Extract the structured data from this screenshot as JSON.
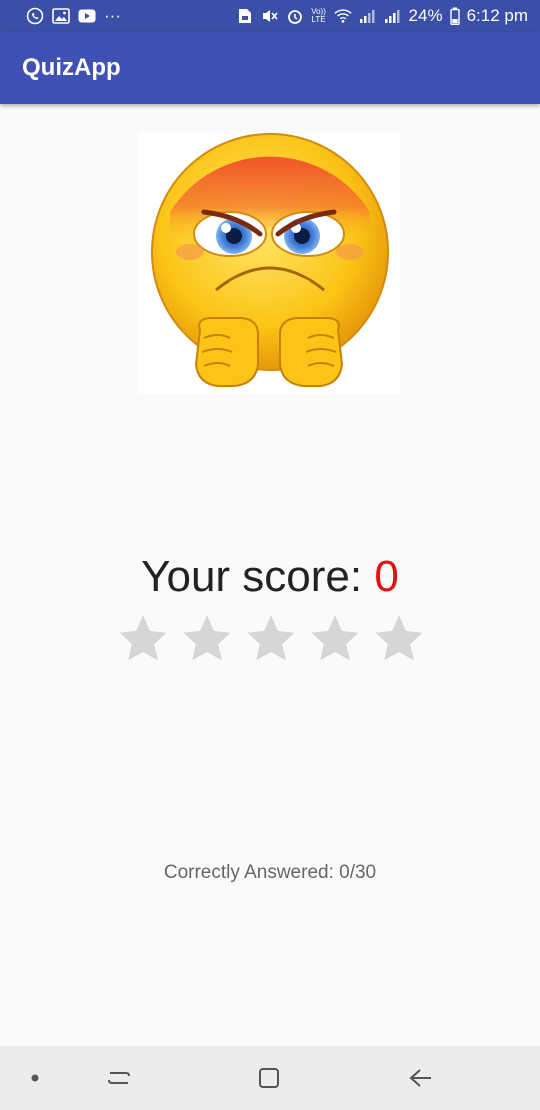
{
  "status_bar": {
    "battery_text": "24%",
    "time": "6:12 pm",
    "left_icons": [
      "whatsapp-icon",
      "image-icon",
      "youtube-icon",
      "more-dots-icon"
    ],
    "right_icons": [
      "sim-icon",
      "mute-icon",
      "alarm-icon",
      "volte-icon",
      "wifi-icon",
      "signal-icon",
      "signal-icon",
      "battery-icon"
    ],
    "vol_label": "Vo)) LTE",
    "dots": "···"
  },
  "app_bar": {
    "title": "QuizApp"
  },
  "result": {
    "score_label": "Your score: ",
    "score_value": "0",
    "stars_total": 5,
    "stars_filled": 0,
    "answered_text": "Correctly Answered: 0/30"
  },
  "nav_bar": {
    "buttons": [
      "dot-button",
      "recent-apps-button",
      "home-button",
      "back-button"
    ]
  },
  "colors": {
    "app_bar": "#3f51b5",
    "status_bar": "#3a4fa8",
    "score_value": "#e0120f",
    "star_empty": "#d6d6d6"
  }
}
